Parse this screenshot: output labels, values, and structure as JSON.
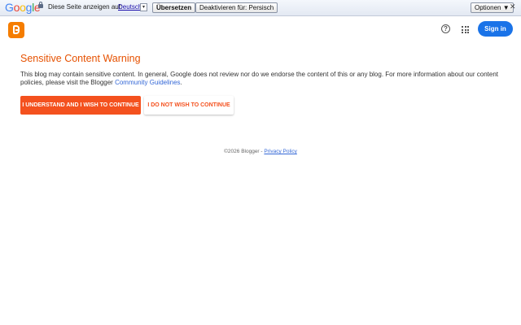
{
  "translate_bar": {
    "logo_letters": [
      {
        "ch": "G",
        "color": "#4285f4"
      },
      {
        "ch": "o",
        "color": "#ea4335"
      },
      {
        "ch": "o",
        "color": "#fbbc05"
      },
      {
        "ch": "g",
        "color": "#4285f4"
      },
      {
        "ch": "l",
        "color": "#34a853"
      },
      {
        "ch": "e",
        "color": "#ea4335"
      }
    ],
    "label": "Diese Seite anzeigen auf:",
    "language": "Deutsch",
    "translate_button": "Übersetzen",
    "disable_button": "Deaktivieren für: Persisch",
    "options_button": "Optionen ▼",
    "close": "✕"
  },
  "header": {
    "help_glyph": "?",
    "sign_in": "Sign in"
  },
  "warning": {
    "title": "Sensitive Content Warning",
    "text": "This blog may contain sensitive content. In general, Google does not review nor do we endorse the content of this or any blog. For more information about our content policies, please visit the Blogger ",
    "link": "Community Guidelines",
    "link_suffix": ".",
    "continue_button": "I UNDERSTAND AND I WISH TO CONTINUE",
    "decline_button": "I DO NOT WISH TO CONTINUE"
  },
  "footer": {
    "copyright": "©2026 Blogger - ",
    "privacy": "Privacy Policy"
  },
  "colors": {
    "accent": "#f4511e",
    "title": "#e65100",
    "link": "#3367d6",
    "signin": "#1a73e8",
    "blogger_logo": "#f57d00"
  }
}
